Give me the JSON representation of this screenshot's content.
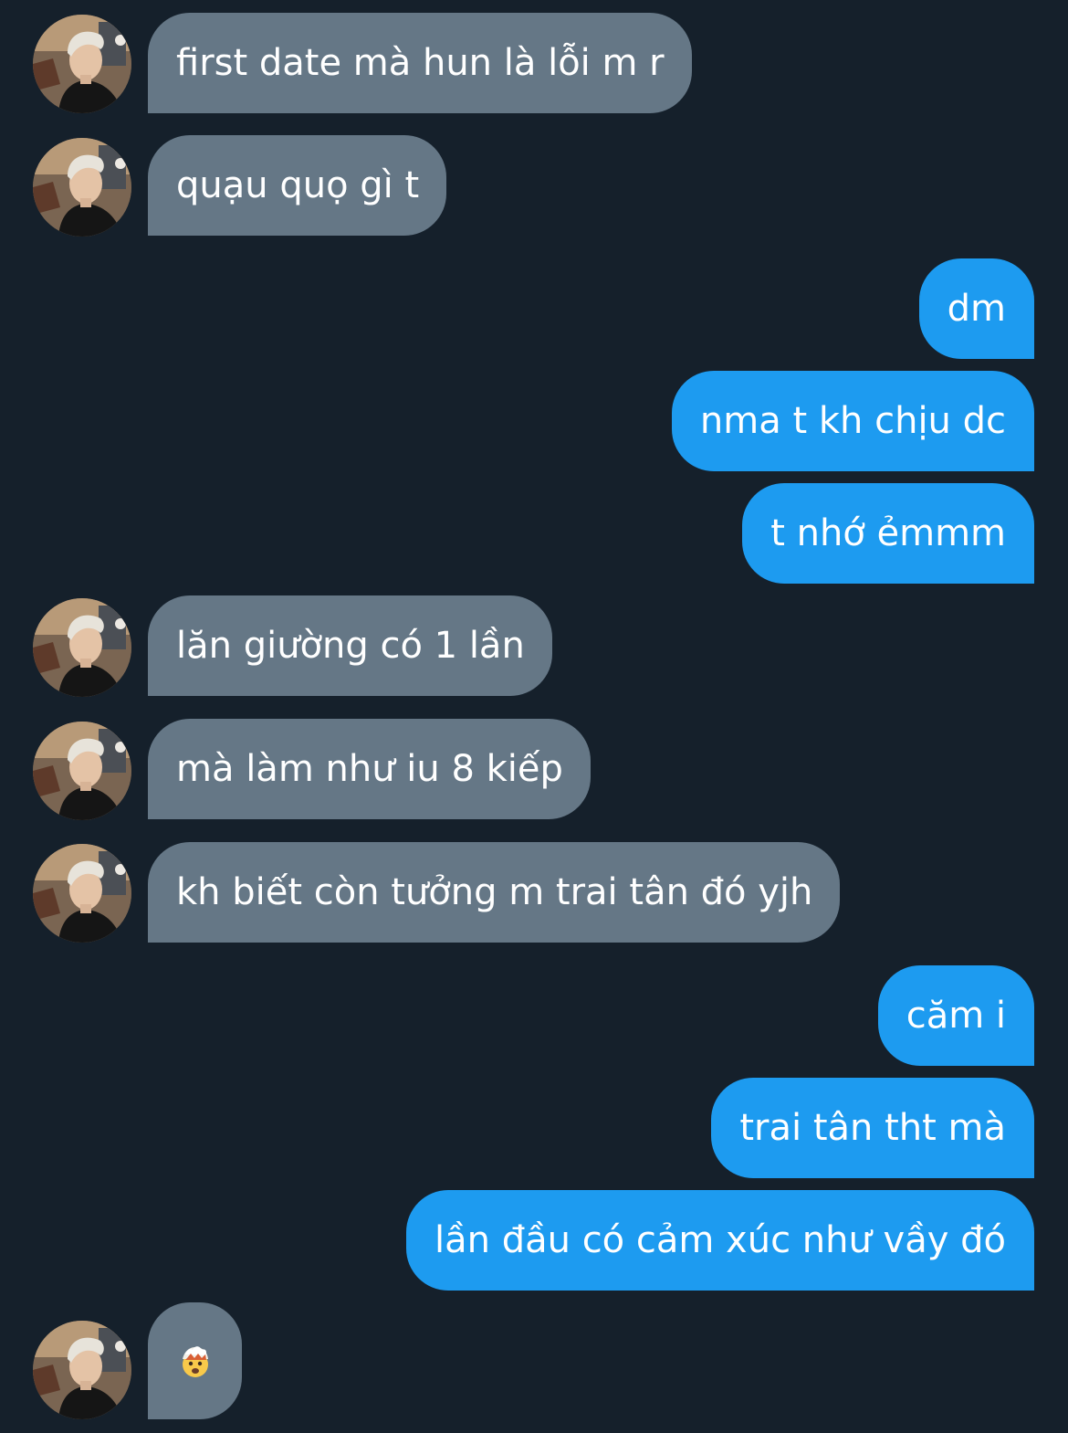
{
  "conversation": {
    "messages": [
      {
        "direction": "received",
        "text": "first date mà hun là lỗi m r"
      },
      {
        "direction": "received",
        "text": "quạu quọ gì t"
      },
      {
        "direction": "sent",
        "text": "dm"
      },
      {
        "direction": "sent",
        "text": "nma t kh chịu dc"
      },
      {
        "direction": "sent",
        "text": "t nhớ ẻmmm"
      },
      {
        "direction": "received",
        "text": "lăn giường có 1 lần"
      },
      {
        "direction": "received",
        "text": "mà làm như iu 8 kiếp"
      },
      {
        "direction": "received",
        "text": "kh biết còn tưởng m trai tân đó yjh"
      },
      {
        "direction": "sent",
        "text": "căm i"
      },
      {
        "direction": "sent",
        "text": "trai tân tht mà"
      },
      {
        "direction": "sent",
        "text": "lần đầu có cảm xúc như vầy đó"
      },
      {
        "direction": "received",
        "emoji": "exploding-head-emoji"
      }
    ]
  },
  "colors": {
    "background": "#15202b",
    "received_bubble": "#657786",
    "sent_bubble": "#1d9bf0",
    "text": "#ffffff"
  },
  "icons": {
    "avatar": "contact-avatar-photo",
    "reaction": "exploding-head-emoji"
  }
}
